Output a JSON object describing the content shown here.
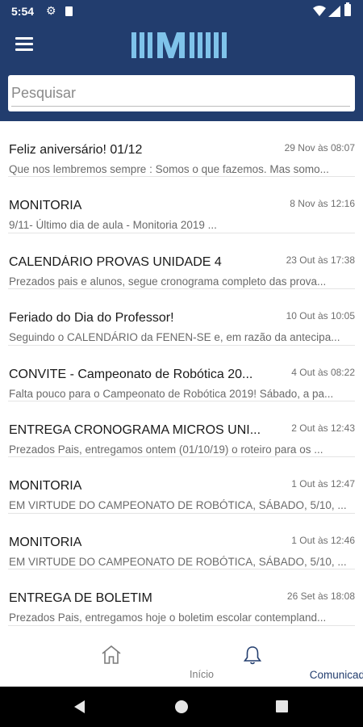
{
  "status_bar": {
    "time": "5:54"
  },
  "app": {
    "logo_text": "IIIMIII"
  },
  "search": {
    "placeholder": "Pesquisar"
  },
  "messages": [
    {
      "title": "Feliz aniversário! 01/12",
      "date": "29 Nov às 08:07",
      "preview": "Que nos lembremos sempre : Somos o que fazemos. Mas somo..."
    },
    {
      "title": "MONITORIA",
      "date": "8 Nov às 12:16",
      "preview": " 9/11- Último dia de aula - Monitoria 2019 ..."
    },
    {
      "title": "CALENDÁRIO PROVAS UNIDADE 4",
      "date": "23 Out às 17:38",
      "preview": "Prezados pais e alunos, segue cronograma completo das prova..."
    },
    {
      "title": "Feriado do Dia do Professor!",
      "date": "10 Out às 10:05",
      "preview": "Seguindo o CALENDÁRIO da FENEN-SE e, em razão da antecipa..."
    },
    {
      "title": "CONVITE - Campeonato de Robótica 20...",
      "date": "4 Out às 08:22",
      "preview": "Falta pouco para o Campeonato de Robótica 2019! Sábado, a pa..."
    },
    {
      "title": "ENTREGA CRONOGRAMA MICROS UNI...",
      "date": "2 Out às 12:43",
      "preview": "Prezados Pais, entregamos ontem (01/10/19) o roteiro para os ..."
    },
    {
      "title": "MONITORIA",
      "date": "1 Out às 12:47",
      "preview": "EM VIRTUDE DO CAMPEONATO DE ROBÓTICA, SÁBADO, 5/10, ..."
    },
    {
      "title": "MONITORIA",
      "date": "1 Out às 12:46",
      "preview": "EM VIRTUDE DO CAMPEONATO DE ROBÓTICA, SÁBADO, 5/10, ..."
    },
    {
      "title": "ENTREGA DE BOLETIM",
      "date": "26 Set às 18:08",
      "preview": "Prezados Pais, entregamos hoje o boletim escolar contempland..."
    }
  ],
  "bottom_nav": [
    {
      "label": "Início",
      "icon": "home-icon",
      "active": false
    },
    {
      "label": "Comunicados",
      "icon": "bell-icon",
      "active": true
    }
  ],
  "colors": {
    "primary": "#223d6e",
    "logo": "#7fc3ea",
    "inactive": "#7b7b7b"
  }
}
